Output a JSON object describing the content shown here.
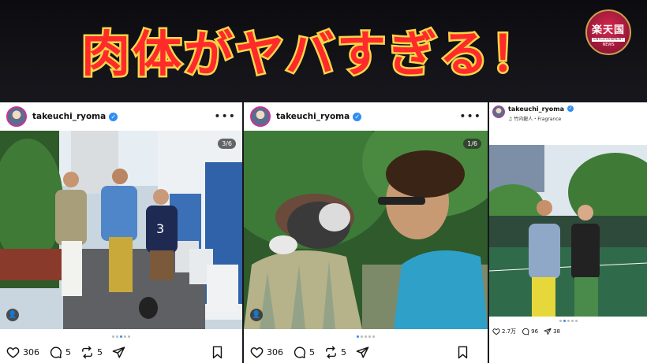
{
  "headline": {
    "text": "肉体がヤバすぎる！",
    "fill": "#ff2a2a",
    "stroke": "#f5d64a"
  },
  "logo": {
    "main": "楽天国",
    "line2": "ENTERTAINMENT",
    "line3": "NEWS"
  },
  "posts": [
    {
      "username": "takeuchi_ryoma",
      "counter": "3/6",
      "likes": "306",
      "comments": "5",
      "reposts": "5"
    },
    {
      "username": "takeuchi_ryoma",
      "counter": "1/6",
      "likes": "306",
      "comments": "5",
      "reposts": "5"
    },
    {
      "username": "takeuchi_ryoma",
      "audio": "♫ 竹内龍人・Fragrance",
      "likes": "2.7万",
      "comments": "96",
      "shares": "38"
    }
  ],
  "icons": [
    "heart-icon",
    "comment-icon",
    "repost-icon",
    "share-icon",
    "bookmark-icon",
    "more-icon",
    "verified-icon",
    "user-tag-icon"
  ]
}
